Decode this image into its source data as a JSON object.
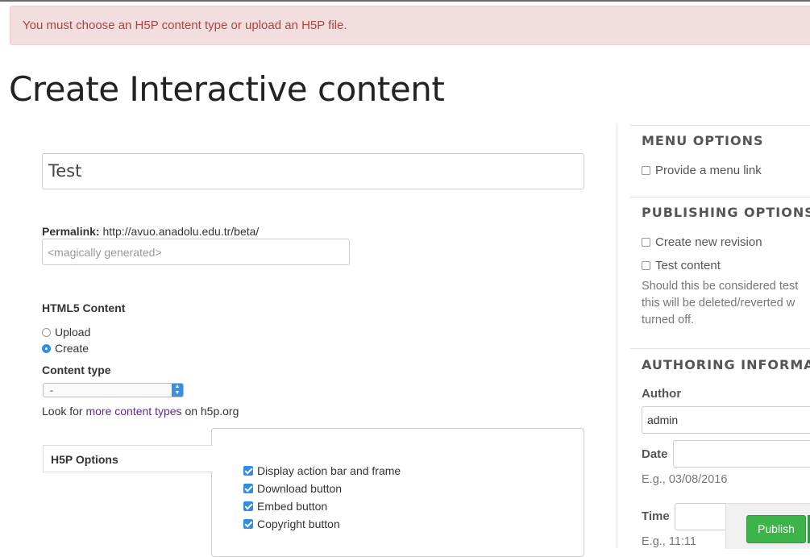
{
  "alert": {
    "message": "You must choose an H5P content type or upload an H5P file."
  },
  "page": {
    "title": "Create Interactive content"
  },
  "form": {
    "title_value": "Test",
    "permalink": {
      "label": "Permalink:",
      "base_url": "http://avuo.anadolu.edu.tr/beta/",
      "placeholder": "<magically generated>"
    },
    "html5": {
      "label": "HTML5 Content",
      "options": [
        {
          "label": "Upload",
          "selected": false
        },
        {
          "label": "Create",
          "selected": true
        }
      ]
    },
    "content_type": {
      "label": "Content type",
      "selected": "-",
      "look_for_prefix": "Look for",
      "look_for_link": "more content types",
      "look_for_suffix": "on h5p.org"
    },
    "h5p_options": {
      "tab_label": "H5P Options",
      "checkboxes": [
        {
          "label": "Display action bar and frame",
          "checked": true
        },
        {
          "label": "Download button",
          "checked": true
        },
        {
          "label": "Embed button",
          "checked": true
        },
        {
          "label": "Copyright button",
          "checked": true
        }
      ]
    }
  },
  "sidebar": {
    "menu_options": {
      "heading": "MENU OPTIONS",
      "provide_menu_link": "Provide a menu link"
    },
    "publishing_options": {
      "heading": "PUBLISHING OPTIONS",
      "create_new_revision": "Create new revision",
      "test_content": "Test content",
      "description_lines": [
        "Should this be considered test",
        "this will be deleted/reverted w",
        "turned off."
      ]
    },
    "authoring": {
      "heading": "AUTHORING INFORMATIO",
      "author_label": "Author",
      "author_value": "admin",
      "date_label": "Date",
      "date_hint": "E.g., 03/08/2016",
      "time_label": "Time",
      "time_hint": "E.g., 11:11"
    }
  },
  "actions": {
    "publish_label": "Publish"
  },
  "colors": {
    "accent": "#2f8de4",
    "alert_bg": "#f2dede",
    "alert_text": "#a94442",
    "publish": "#3cb44a"
  }
}
